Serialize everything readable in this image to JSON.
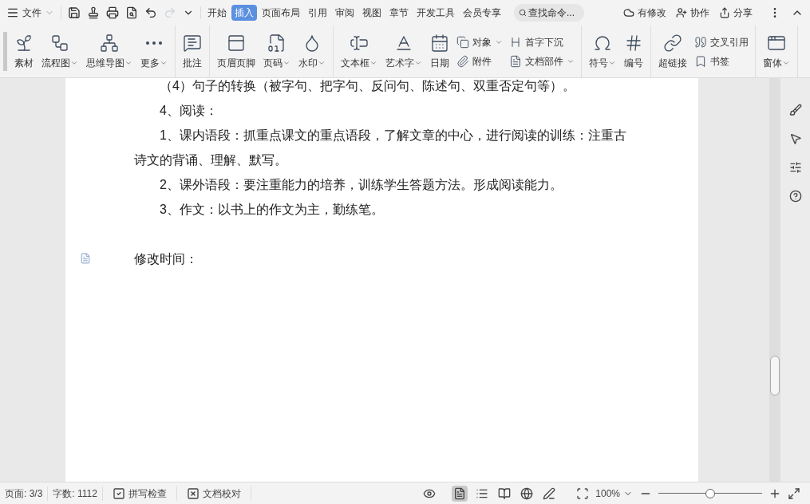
{
  "menu": {
    "label": "文件"
  },
  "tabs": [
    {
      "label": "开始",
      "selected": false
    },
    {
      "label": "插入",
      "selected": true
    },
    {
      "label": "页面布局",
      "selected": false
    },
    {
      "label": "引用",
      "selected": false
    },
    {
      "label": "审阅",
      "selected": false
    },
    {
      "label": "视图",
      "selected": false
    },
    {
      "label": "章节",
      "selected": false
    },
    {
      "label": "开发工具",
      "selected": false
    },
    {
      "label": "会员专享",
      "selected": false
    }
  ],
  "search": {
    "placeholder": "查找命令..."
  },
  "top_actions": [
    {
      "label": "有修改"
    },
    {
      "label": "协作"
    },
    {
      "label": "分享"
    }
  ],
  "ribbon": [
    {
      "items": [
        {
          "kind": "large",
          "label": "素材",
          "dropdown": false
        },
        {
          "kind": "large",
          "label": "流程图",
          "dropdown": true
        },
        {
          "kind": "large",
          "label": "思维导图",
          "dropdown": true
        },
        {
          "kind": "large",
          "label": "更多",
          "dropdown": true
        }
      ]
    },
    {
      "items": [
        {
          "kind": "large",
          "label": "批注",
          "dropdown": false
        }
      ]
    },
    {
      "items": [
        {
          "kind": "large",
          "label": "页眉页脚",
          "dropdown": false
        },
        {
          "kind": "large",
          "label": "页码",
          "dropdown": true
        },
        {
          "kind": "large",
          "label": "水印",
          "dropdown": true
        }
      ]
    },
    {
      "items": [
        {
          "kind": "large",
          "label": "文本框",
          "dropdown": true
        },
        {
          "kind": "large",
          "label": "艺术字",
          "dropdown": true
        },
        {
          "kind": "large",
          "label": "日期",
          "dropdown": false
        },
        {
          "kind": "stack",
          "items": [
            {
              "label": "对象",
              "dropdown": true
            },
            {
              "label": "附件",
              "dropdown": false
            }
          ]
        },
        {
          "kind": "stack",
          "items": [
            {
              "label": "首字下沉",
              "dropdown": false
            },
            {
              "label": "文档部件",
              "dropdown": true
            }
          ]
        }
      ]
    },
    {
      "items": [
        {
          "kind": "large",
          "label": "符号",
          "dropdown": true
        },
        {
          "kind": "large",
          "label": "编号",
          "dropdown": false
        }
      ]
    },
    {
      "items": [
        {
          "kind": "large",
          "label": "超链接",
          "dropdown": false
        },
        {
          "kind": "stack",
          "items": [
            {
              "label": "交叉引用",
              "dropdown": false
            },
            {
              "label": "书签",
              "dropdown": false
            }
          ]
        }
      ]
    },
    {
      "items": [
        {
          "kind": "large",
          "label": "窗体",
          "dropdown": true
        }
      ]
    }
  ],
  "document": {
    "paragraphs": [
      {
        "text": "（4）句子的转换（被字句、把字句、反问句、陈述句、双重否定句等）。",
        "indent": true
      },
      {
        "text": "4、阅读：",
        "indent": true
      },
      {
        "text": "1、课内语段：抓重点课文的重点语段，了解文章的中心，进行阅读的训练：注重古诗文的背诵、理解、默写。",
        "indent": true
      },
      {
        "text": "2、课外语段：要注重能力的培养，训练学生答题方法。形成阅读能力。",
        "indent": true
      },
      {
        "text": "3、作文：以书上的作文为主，勤练笔。",
        "indent": true
      },
      {
        "text": "修改时间：",
        "indent": false,
        "comment_marker": true
      }
    ]
  },
  "status_bar": {
    "items": [
      {
        "kind": "text",
        "label": "页面: 3/3"
      },
      {
        "kind": "text",
        "label": "字数: 1112"
      },
      {
        "kind": "check",
        "label": "拼写检查"
      },
      {
        "kind": "proof",
        "label": "文档校对"
      }
    ],
    "views": [
      {
        "selected": true
      },
      {
        "selected": false
      },
      {
        "selected": false
      },
      {
        "selected": false
      },
      {
        "selected": false
      }
    ],
    "zoom": {
      "value": "100%",
      "level": 0.5
    }
  }
}
